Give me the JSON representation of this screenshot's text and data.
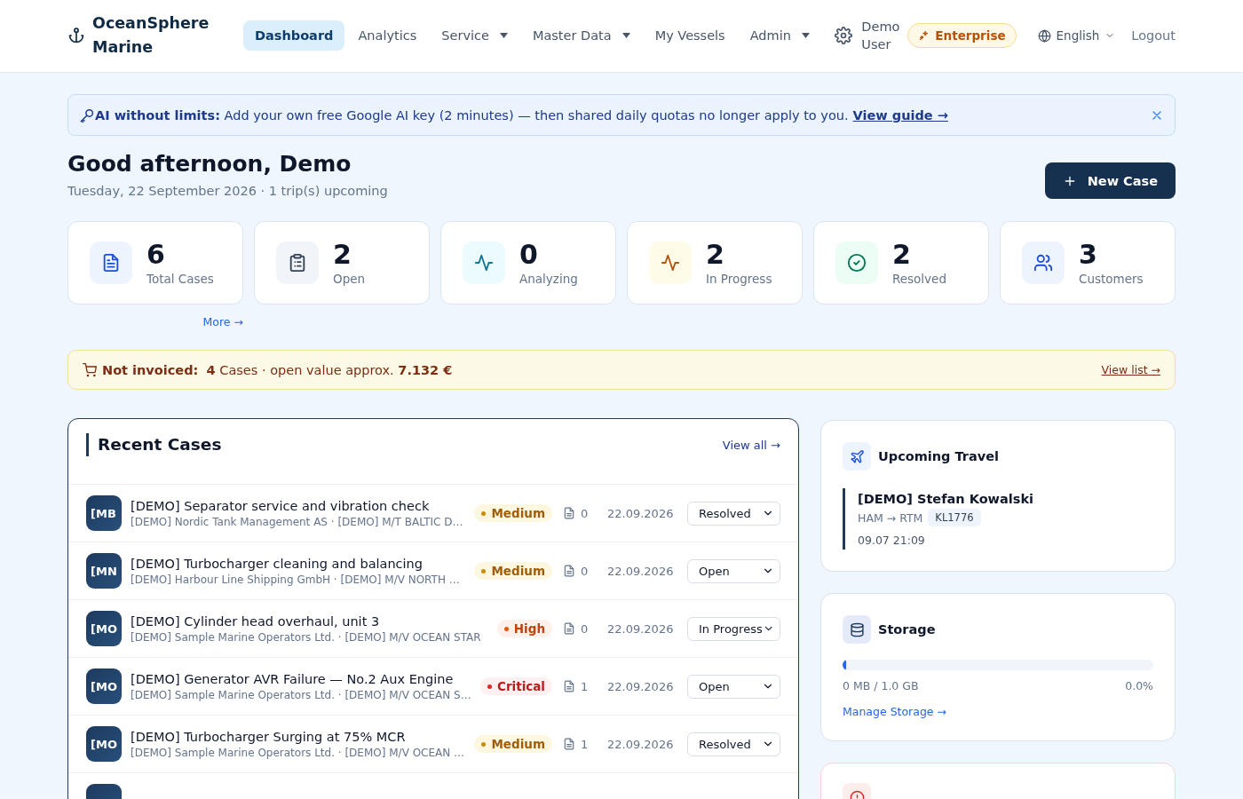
{
  "brand": {
    "name": "OceanSphere Marine"
  },
  "nav": [
    {
      "label": "Dashboard",
      "selected": true,
      "dropdown": false
    },
    {
      "label": "Analytics",
      "selected": false,
      "dropdown": false
    },
    {
      "label": "Service",
      "selected": false,
      "dropdown": true
    },
    {
      "label": "Master Data",
      "selected": false,
      "dropdown": true
    },
    {
      "label": "My Vessels",
      "selected": false,
      "dropdown": false
    },
    {
      "label": "Admin",
      "selected": false,
      "dropdown": true
    }
  ],
  "user": {
    "name": "Demo User",
    "plan": "Enterprise"
  },
  "language": "English",
  "logout": "Logout",
  "banner": {
    "text": "**AI without limits:** Add your own free Google AI key (2 minutes) — then shared daily quotas no longer apply to you.",
    "link": "View guide →"
  },
  "greeting": {
    "title": "Good afternoon, Demo",
    "subtitle": "Tuesday, 22 September 2026 · 1 trip(s) upcoming"
  },
  "new_case_button": "New Case",
  "stats": [
    {
      "value": "6",
      "label": "Total Cases",
      "kind": "document"
    },
    {
      "value": "2",
      "label": "Open",
      "kind": "clipboard"
    },
    {
      "value": "0",
      "label": "Analyzing",
      "kind": "analyzing"
    },
    {
      "value": "2",
      "label": "In Progress",
      "kind": "progress"
    },
    {
      "value": "2",
      "label": "Resolved",
      "kind": "resolved"
    },
    {
      "value": "3",
      "label": "Customers",
      "kind": "customers"
    }
  ],
  "more_link": "More →",
  "invoice": {
    "text": "**Not invoiced:**  **4** Cases · open value approx. **7.132 €**",
    "link": "View list →"
  },
  "recent_cases": {
    "title": "Recent Cases",
    "view_all": "View all →",
    "rows": [
      {
        "initials": "[MB",
        "title": "[DEMO] Separator service and vibration check",
        "subtitle": "[DEMO] Nordic Tank Management AS · [DEMO] M/T BALTIC D…",
        "priority": "Medium",
        "kind": "medium",
        "files": "0",
        "date": "22.09.2026",
        "status": "Resolved"
      },
      {
        "initials": "[MN",
        "title": "[DEMO] Turbocharger cleaning and balancing",
        "subtitle": "[DEMO] Harbour Line Shipping GmbH · [DEMO] M/V NORTH …",
        "priority": "Medium",
        "kind": "medium",
        "files": "0",
        "date": "22.09.2026",
        "status": "Open"
      },
      {
        "initials": "[MO",
        "title": "[DEMO] Cylinder head overhaul, unit 3",
        "subtitle": "[DEMO] Sample Marine Operators Ltd. · [DEMO] M/V OCEAN STAR",
        "priority": "High",
        "kind": "high",
        "files": "0",
        "date": "22.09.2026",
        "status": "In Progress"
      },
      {
        "initials": "[MO",
        "title": "[DEMO] Generator AVR Failure — No.2 Aux Engine",
        "subtitle": "[DEMO] Sample Marine Operators Ltd. · [DEMO] M/V OCEAN S…",
        "priority": "Critical",
        "kind": "critical",
        "files": "1",
        "date": "22.09.2026",
        "status": "Open"
      },
      {
        "initials": "[MO",
        "title": "[DEMO] Turbocharger Surging at 75% MCR",
        "subtitle": "[DEMO] Sample Marine Operators Ltd. · [DEMO] M/V OCEAN …",
        "priority": "Medium",
        "kind": "medium",
        "files": "1",
        "date": "22.09.2026",
        "status": "Resolved"
      }
    ]
  },
  "travel": {
    "title": "Upcoming Travel",
    "name": "[DEMO] Stefan Kowalski",
    "route": "HAM → RTM",
    "flight": "KL1776",
    "time": "09.07 21:09"
  },
  "storage": {
    "title": "Storage",
    "level": 0.0,
    "used": "0 MB / 1.0 GB",
    "percent": "0.0%",
    "link": "Manage Storage →"
  }
}
